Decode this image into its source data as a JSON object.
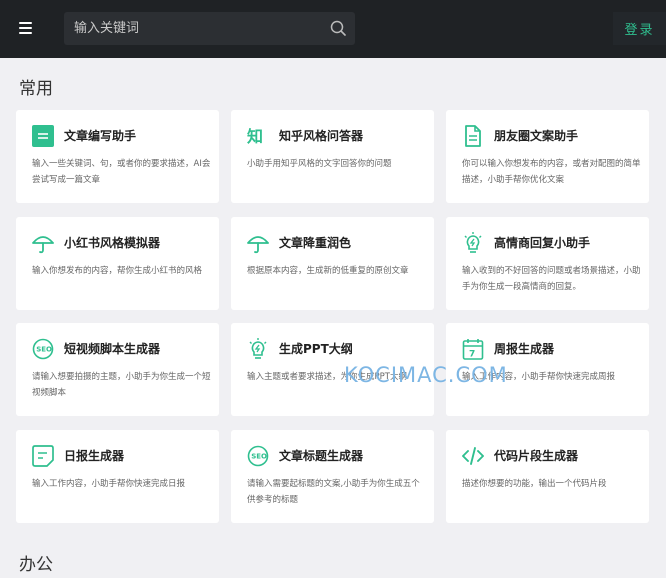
{
  "header": {
    "search_placeholder": "输入关键词",
    "login_label": "登录"
  },
  "sections": [
    {
      "title": "常用"
    },
    {
      "title": "办公"
    }
  ],
  "cards": [
    {
      "title": "文章编写助手",
      "desc": "输入一些关键词、句，或者你的要求描述，AI会尝试写成一篇文章",
      "icon": "article-icon"
    },
    {
      "title": "知乎风格问答器",
      "desc": "小助手用知乎风格的文字回答你的问题",
      "icon": "zhihu-icon"
    },
    {
      "title": "朋友圈文案助手",
      "desc": "你可以输入你想发布的内容，或者对配图的简单描述，小助手帮你优化文案",
      "icon": "document-icon"
    },
    {
      "title": "小红书风格模拟器",
      "desc": "输入你想发布的内容，帮你生成小红书的风格",
      "icon": "umbrella-icon"
    },
    {
      "title": "文章降重润色",
      "desc": "根据原本内容，生成新的低重复的原创文章",
      "icon": "umbrella-icon"
    },
    {
      "title": "高情商回复小助手",
      "desc": "输入收到的不好回答的问题或者场景描述，小助手为你生成一段高情商的回复。",
      "icon": "lightbulb-icon"
    },
    {
      "title": "短视频脚本生成器",
      "desc": "请输入想要拍摄的主题，小助手为你生成一个短视频脚本",
      "icon": "seo-icon"
    },
    {
      "title": "生成PPT大纲",
      "desc": "输入主题或者要求描述，为你生成PPT大纲",
      "icon": "lightbulb-icon"
    },
    {
      "title": "周报生成器",
      "desc": "输入工作内容，小助手帮你快速完成周报",
      "icon": "calendar-icon"
    },
    {
      "title": "日报生成器",
      "desc": "输入工作内容，小助手帮你快速完成日报",
      "icon": "note-icon"
    },
    {
      "title": "文章标题生成器",
      "desc": "请输入需要起标题的文案,小助手为你生成五个供参考的标题",
      "icon": "seo-icon"
    },
    {
      "title": "代码片段生成器",
      "desc": "描述你想要的功能，输出一个代码片段",
      "icon": "code-icon"
    }
  ],
  "watermark": {
    "text": "KOCIMAC.COM"
  },
  "colors": {
    "accent": "#2fbf8f",
    "topbar": "#1f2225",
    "background": "#f0f0f3"
  }
}
